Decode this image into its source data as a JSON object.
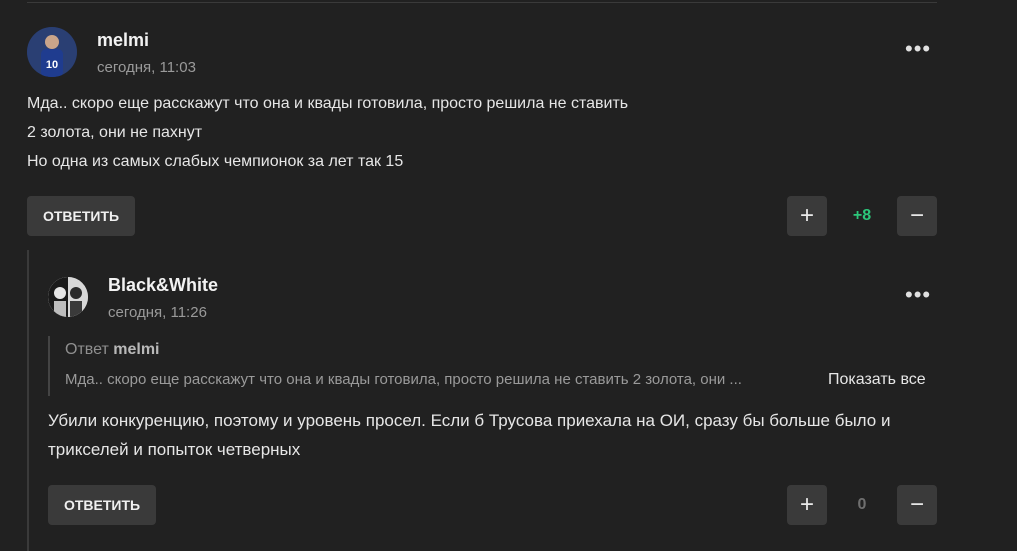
{
  "comment1": {
    "author": "melmi",
    "time": "сегодня, 11:03",
    "lines": [
      "Мда.. скоро еще расскажут что она и квады готовила, просто решила не ставить",
      "2 золота, они не пахнут",
      "Но одна из самых слабых чемпионок за лет так 15"
    ],
    "reply_label": "ОТВЕТИТЬ",
    "score": "+8",
    "score_color": "#2cc77a"
  },
  "comment2": {
    "author": "Black&White",
    "time": "сегодня, 11:26",
    "quote": {
      "prefix": "Ответ",
      "to": "melmi",
      "text": "Мда.. скоро еще расскажут что она и квады готовила, просто решила не ставить 2 золота, они ...",
      "show_all": "Показать все"
    },
    "lines": [
      "Убили конкуренцию, поэтому и уровень просел. Если б Трусова приехала на ОИ, сразу бы больше было и",
      "трикселей и попыток четверных"
    ],
    "reply_label": "ОТВЕТИТЬ",
    "score": "0",
    "score_color": "#6f6f6f"
  },
  "icons": {
    "more": "•••",
    "plus": "+",
    "minus": "−"
  }
}
